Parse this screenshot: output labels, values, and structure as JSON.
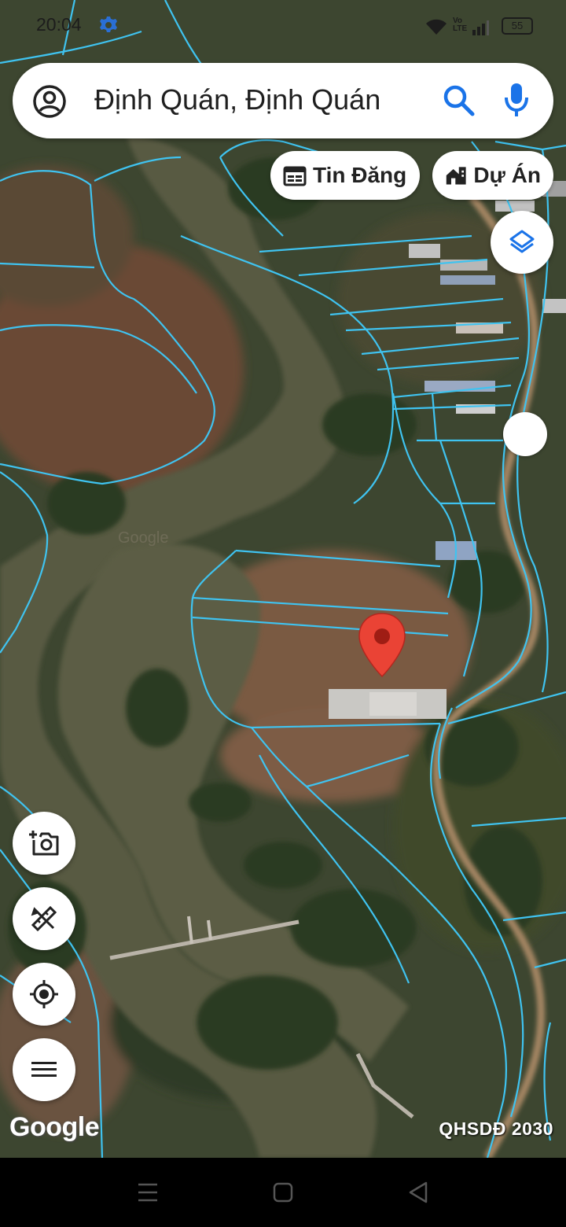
{
  "status_bar": {
    "time": "20:04",
    "network_label": "Vo LTE",
    "battery": "55",
    "icons": [
      "settings-gear-icon",
      "wifi-icon",
      "signal-icon",
      "battery-icon"
    ]
  },
  "search": {
    "query": "Định Quán, Định Quán",
    "icons": [
      "account-icon",
      "search-icon",
      "mic-icon"
    ]
  },
  "chips": [
    {
      "label": "Tin Đăng",
      "icon": "calendar-icon"
    },
    {
      "label": "Dự Án",
      "icon": "buildings-icon"
    }
  ],
  "map": {
    "provider": "Google",
    "overlay_label": "QHSDĐ 2030",
    "faint_watermark": "Google",
    "marker_color": "#ea4335",
    "parcel_line_color": "#3fc3f0",
    "view": "satellite"
  },
  "controls": [
    {
      "name": "add-photo",
      "icon": "camera-plus-icon"
    },
    {
      "name": "measure",
      "icon": "ruler-pencil-icon"
    },
    {
      "name": "my-location",
      "icon": "crosshair-icon"
    },
    {
      "name": "menu",
      "icon": "hamburger-menu-icon"
    }
  ],
  "nav": [
    "recents-icon",
    "home-icon",
    "back-icon"
  ]
}
